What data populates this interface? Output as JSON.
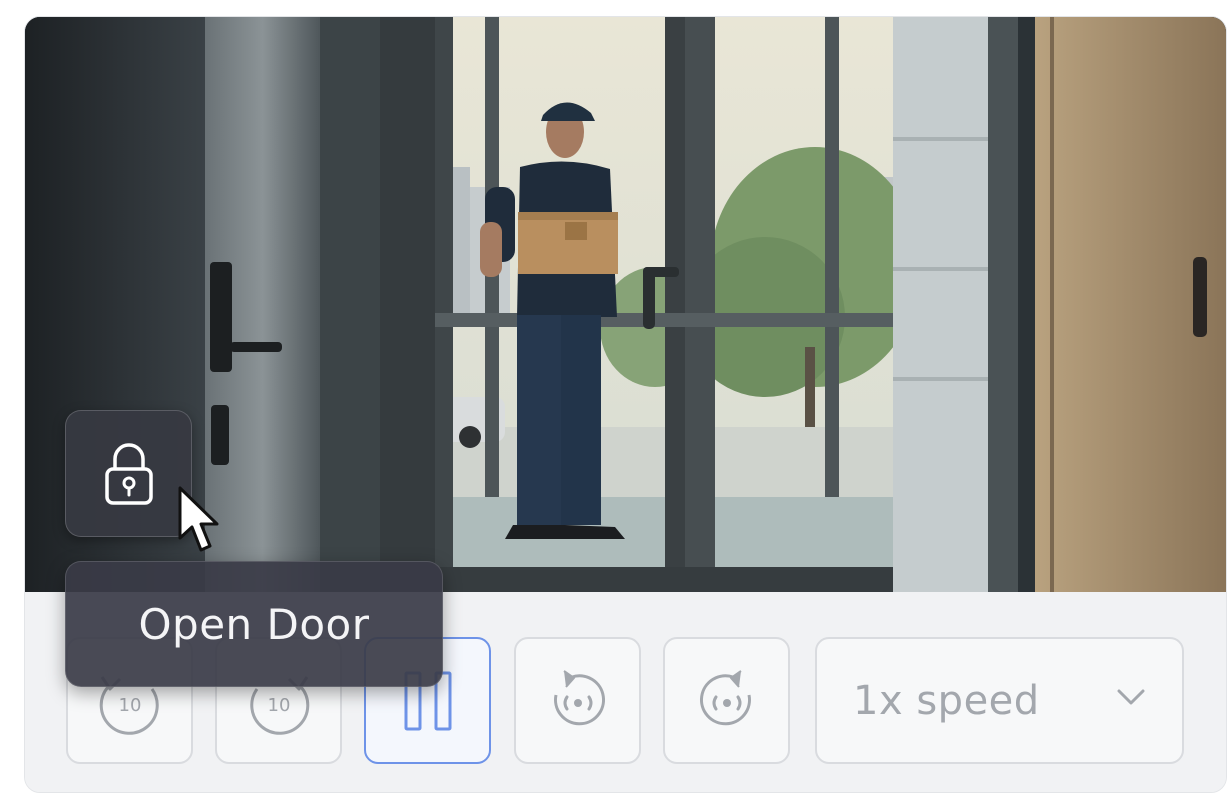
{
  "video": {
    "scene": "doorway-camera-feed"
  },
  "controls": {
    "rewind_10": {
      "seconds_label": "10",
      "icon": "rewind-10-icon"
    },
    "forward_10": {
      "seconds_label": "10",
      "icon": "forward-10-icon"
    },
    "pause": {
      "icon": "pause-icon",
      "state": "active"
    },
    "rotate_left": {
      "icon": "rotate-left-icon"
    },
    "rotate_right": {
      "icon": "rotate-right-icon"
    },
    "speed": {
      "value": "1x speed",
      "icon": "chevron-down-icon"
    }
  },
  "overlay": {
    "lock_button": {
      "icon": "lock-icon"
    },
    "tooltip": {
      "text": "Open Door"
    }
  },
  "colors": {
    "active_border": "#6e93e8",
    "overlay_bg": "#3a3b46",
    "control_bar_bg": "#f1f2f4",
    "muted_text": "#a3a7ad"
  }
}
